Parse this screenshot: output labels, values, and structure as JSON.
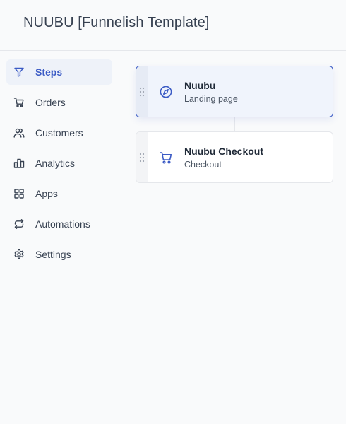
{
  "header": {
    "title": "NUUBU [Funnelish Template]"
  },
  "sidebar": {
    "items": [
      {
        "label": "Steps",
        "icon": "filter-icon",
        "active": true
      },
      {
        "label": "Orders",
        "icon": "cart-icon"
      },
      {
        "label": "Customers",
        "icon": "users-icon"
      },
      {
        "label": "Analytics",
        "icon": "bar-chart-icon"
      },
      {
        "label": "Apps",
        "icon": "grid-icon"
      },
      {
        "label": "Automations",
        "icon": "repeat-icon"
      },
      {
        "label": "Settings",
        "icon": "gear-icon"
      }
    ]
  },
  "steps": [
    {
      "name": "Nuubu",
      "type": "Landing page",
      "icon": "compass-icon",
      "selected": true
    },
    {
      "name": "Nuubu Checkout",
      "type": "Checkout",
      "icon": "cart-icon"
    }
  ],
  "colors": {
    "accent": "#3b5bc5",
    "sidebar_bg": "#f9fafb",
    "selected_card_bg": "#f0f4fc"
  }
}
